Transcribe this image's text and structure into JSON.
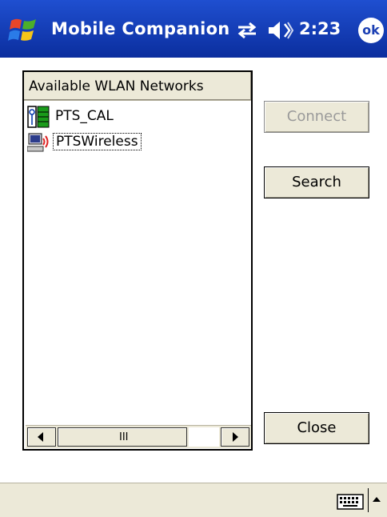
{
  "titlebar": {
    "app_title": "Mobile Companion",
    "clock": "2:23",
    "ok_label": "ok",
    "icons": [
      "windows-flag-icon",
      "connectivity-icon",
      "volume-icon"
    ]
  },
  "network_list": {
    "header": "Available WLAN Networks",
    "items": [
      {
        "label": "PTS_CAL",
        "icon": "access-point-signal-icon"
      },
      {
        "label": "PTSWireless",
        "icon": "adhoc-computer-icon"
      }
    ],
    "scrollbar": {
      "thumb_grip": "III"
    }
  },
  "buttons": {
    "connect": "Connect",
    "search": "Search",
    "close": "Close"
  },
  "bottombar": {
    "icons": [
      "keyboard-icon",
      "sip-arrow-icon"
    ]
  },
  "colors": {
    "titlebar": "#1f4fd0",
    "chrome": "#ece9d8",
    "disabled_text": "#9a9a9a"
  }
}
